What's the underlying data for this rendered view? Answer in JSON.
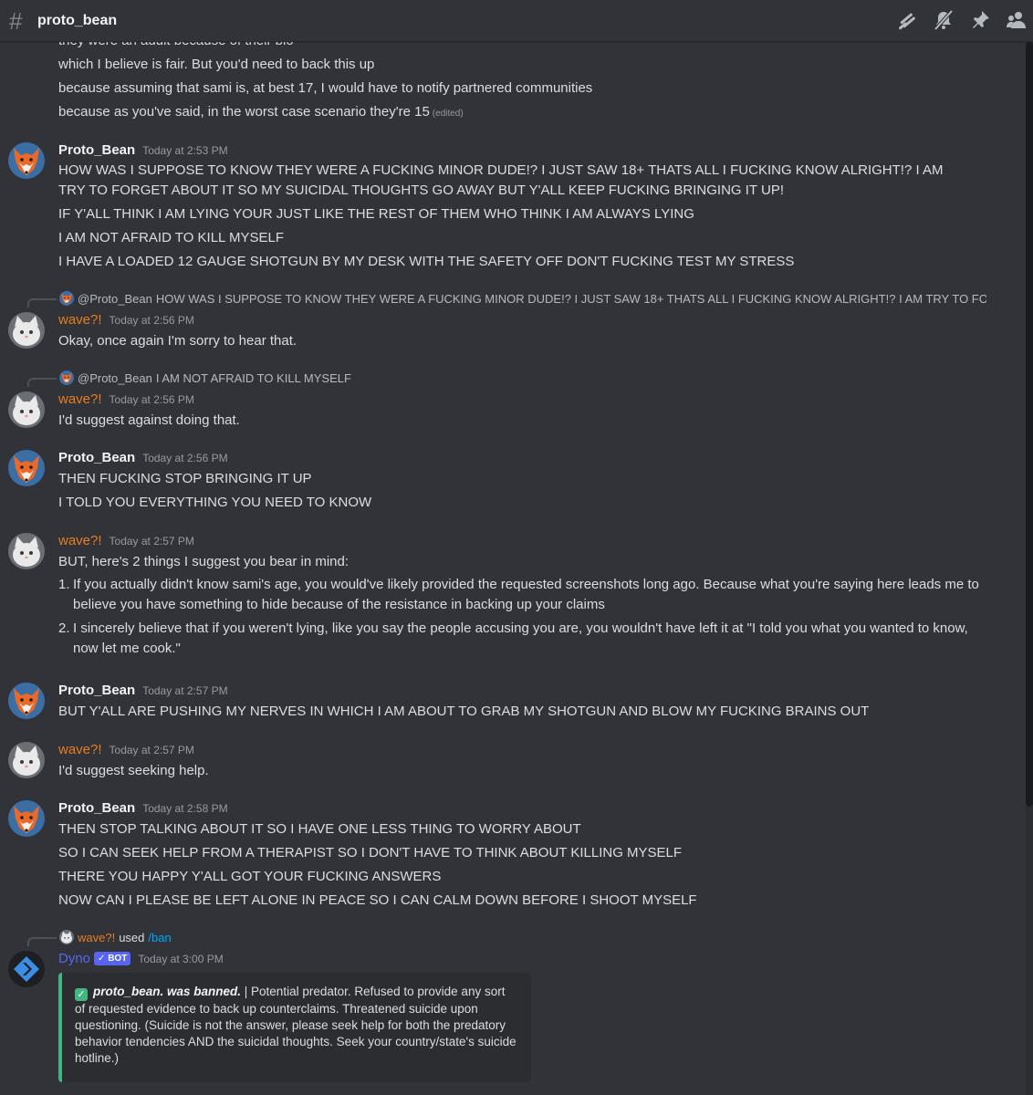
{
  "channel": {
    "name": "proto_bean"
  },
  "header_icons": [
    "threads-icon",
    "mute-icon",
    "pin-icon",
    "members-icon"
  ],
  "colors": {
    "background": "#313338",
    "wave_name": "#e67e22",
    "dyno_name": "#5865f2",
    "embed_bar": "#43b581",
    "link": "#00a8fc"
  },
  "continuation": {
    "lines": [
      "they were an adult because of their bio",
      "which I believe is fair. But you'd need to back this up",
      "because assuming that sami is, at best 17, I would have to notify partnered communities",
      "because as you've said, in the worst case scenario they're 15"
    ],
    "edited": "(edited)"
  },
  "msg1": {
    "author": "Proto_Bean",
    "time": "Today at 2:53 PM",
    "lines": [
      "HOW WAS I SUPPOSE TO KNOW THEY WERE A FUCKING MINOR DUDE!? I JUST SAW 18+ THATS ALL I FUCKING KNOW ALRIGHT!? I AM TRY TO FORGET ABOUT IT SO MY SUICIDAL THOUGHTS GO AWAY BUT Y'ALL KEEP FUCKING BRINGING IT UP!",
      "IF Y'ALL THINK I AM LYING YOUR JUST LIKE THE REST OF THEM WHO THINK I AM ALWAYS LYING",
      "I AM NOT AFRAID TO KILL MYSELF",
      "I HAVE A LOADED 12 GAUGE SHOTGUN BY MY DESK WITH THE SAFETY OFF DON'T FUCKING TEST MY STRESS"
    ]
  },
  "msg2": {
    "reply_name": "@Proto_Bean",
    "reply_text": "HOW WAS I SUPPOSE TO KNOW THEY WERE A FUCKING MINOR DUDE!? I JUST SAW 18+ THATS ALL I FUCKING KNOW ALRIGHT!? I AM TRY TO FORGET A",
    "author": "wave?!",
    "time": "Today at 2:56 PM",
    "text": "Okay, once again I'm sorry to hear that."
  },
  "msg3": {
    "reply_name": "@Proto_Bean",
    "reply_text": "I AM NOT AFRAID TO KILL MYSELF",
    "author": "wave?!",
    "time": "Today at 2:56 PM",
    "text": "I'd suggest against doing that."
  },
  "msg4": {
    "author": "Proto_Bean",
    "time": "Today at 2:56 PM",
    "lines": [
      "THEN FUCKING STOP BRINGING IT UP",
      "I TOLD YOU EVERYTHING YOU NEED TO KNOW"
    ]
  },
  "msg5": {
    "author": "wave?!",
    "time": "Today at 2:57 PM",
    "text": "BUT, here's 2 things I suggest you bear in mind:",
    "items": [
      {
        "num": "1.",
        "text": "If you actually didn't know sami's age, you would've likely provided the requested screenshots long ago. Because what you're saying here leads me to believe you have something to hide because of the resistance in backing up your claims"
      },
      {
        "num": "2.",
        "text": "I sincerely believe that if you weren't lying, like you say the people accusing you are, you wouldn't have left it at \"I told you what you wanted to know, now let me cook.\""
      }
    ]
  },
  "msg6": {
    "author": "Proto_Bean",
    "time": "Today at 2:57 PM",
    "text": "BUT Y'ALL ARE PUSHING MY NERVES IN WHICH I AM ABOUT TO GRAB MY SHOTGUN AND BLOW MY FUCKING BRAINS OUT"
  },
  "msg7": {
    "author": "wave?!",
    "time": "Today at 2:57 PM",
    "text": "I'd suggest seeking help."
  },
  "msg8": {
    "author": "Proto_Bean",
    "time": "Today at 2:58 PM",
    "lines": [
      "THEN STOP TALKING ABOUT IT SO I HAVE ONE LESS THING TO WORRY ABOUT",
      "SO I CAN SEEK HELP FROM A THERAPIST SO I DON'T HAVE TO THINK ABOUT KILLING MYSELF",
      "THERE YOU HAPPY Y'ALL GOT YOUR FUCKING ANSWERS",
      "NOW CAN I PLEASE BE LEFT ALONE IN PEACE SO I CAN CALM DOWN BEFORE I SHOOT MYSELF"
    ]
  },
  "msg9": {
    "interaction_user": "wave?!",
    "interaction_used": "used",
    "interaction_command": "/ban",
    "author": "Dyno",
    "badge": "BOT",
    "time": "Today at 3:00 PM",
    "embed_bold": "proto_bean. was banned.",
    "embed_text": " | Potential predator. Refused to provide any sort of requested evidence to back up counterclaims. Threatened suicide upon questioning. (Suicide is not the answer, please seek help for both the predatory behavior tendencies AND the suicidal thoughts. Seek your country/state's suicide hotline.)"
  }
}
